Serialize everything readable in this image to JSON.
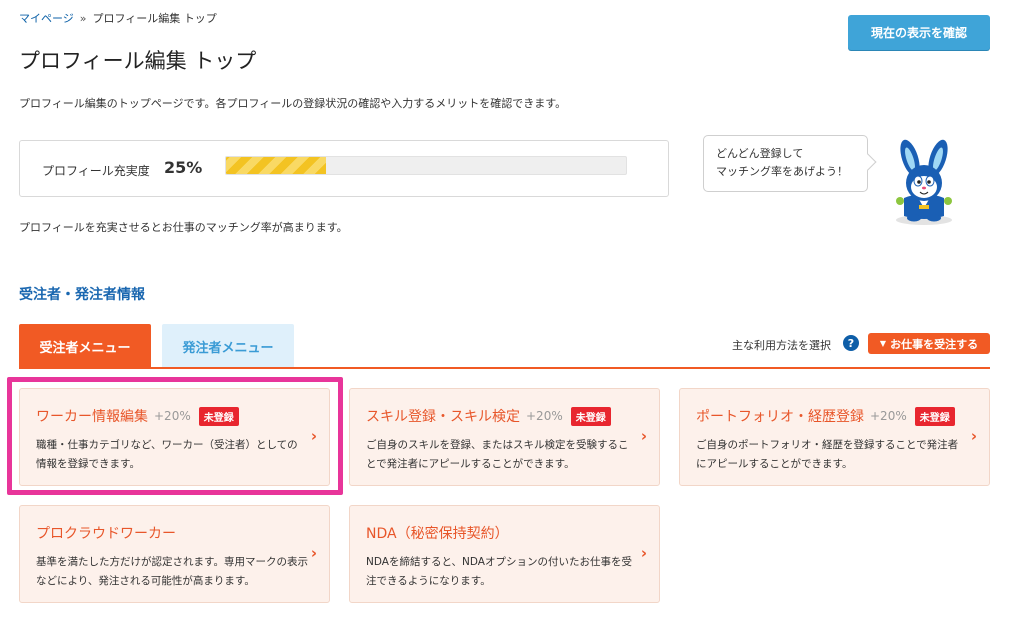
{
  "breadcrumb": {
    "home": "マイページ",
    "separator": "»",
    "current": "プロフィール編集 トップ"
  },
  "header": {
    "confirm_button": "現在の表示を確認",
    "title": "プロフィール編集 トップ",
    "description": "プロフィール編集のトップページです。各プロフィールの登録状況の確認や入力するメリットを確認できます。"
  },
  "profile": {
    "label": "プロフィール充実度",
    "percent_text": "25%",
    "percent_value": 25,
    "bar_color": "#f3c322"
  },
  "bubble": {
    "line1": "どんどん登録して",
    "line2": "マッチング率をあげよう！"
  },
  "matching_note": "プロフィールを充実させるとお仕事のマッチング率が高まります。",
  "section": {
    "title": "受注者・発注者情報",
    "tabs": [
      {
        "label": "受注者メニュー",
        "active": true
      },
      {
        "label": "発注者メニュー",
        "active": false
      }
    ],
    "usage_label": "主な利用方法を選択",
    "help_icon": "?",
    "receive_button": "お仕事を受注する"
  },
  "cards": [
    {
      "title": "ワーカー情報編集",
      "pct": "+20%",
      "badge": "未登録",
      "desc": "職種・仕事カテゴリなど、ワーカー（受注者）としての情報を登録できます。"
    },
    {
      "title": "スキル登録・スキル検定",
      "pct": "+20%",
      "badge": "未登録",
      "desc": "ご自身のスキルを登録、またはスキル検定を受験することで発注者にアピールすることができます。"
    },
    {
      "title": "ポートフォリオ・経歴登録",
      "pct": "+20%",
      "badge": "未登録",
      "desc": "ご自身のポートフォリオ・経歴を登録することで発注者にアピールすることができます。"
    },
    {
      "title": "プロクラウドワーカー",
      "desc": "基準を満たした方だけが認定されます。専用マークの表示などにより、発注される可能性が高まります。"
    },
    {
      "title": "NDA（秘密保持契約）",
      "desc": "NDAを締結すると、NDAオプションの付いたお仕事を受注できるようになります。"
    }
  ],
  "colors": {
    "accent": "#f15a24",
    "link": "#1a67b0",
    "confirm_button": "#3fa4d8",
    "badge": "#e8262f",
    "card_background": "#fdf1eb",
    "highlight": "#e8359a"
  },
  "icons": {
    "card_arrow": "chevron-right-icon",
    "receive_arrow": "caret-down-icon",
    "mascot": "rabbit-mascot-icon"
  }
}
